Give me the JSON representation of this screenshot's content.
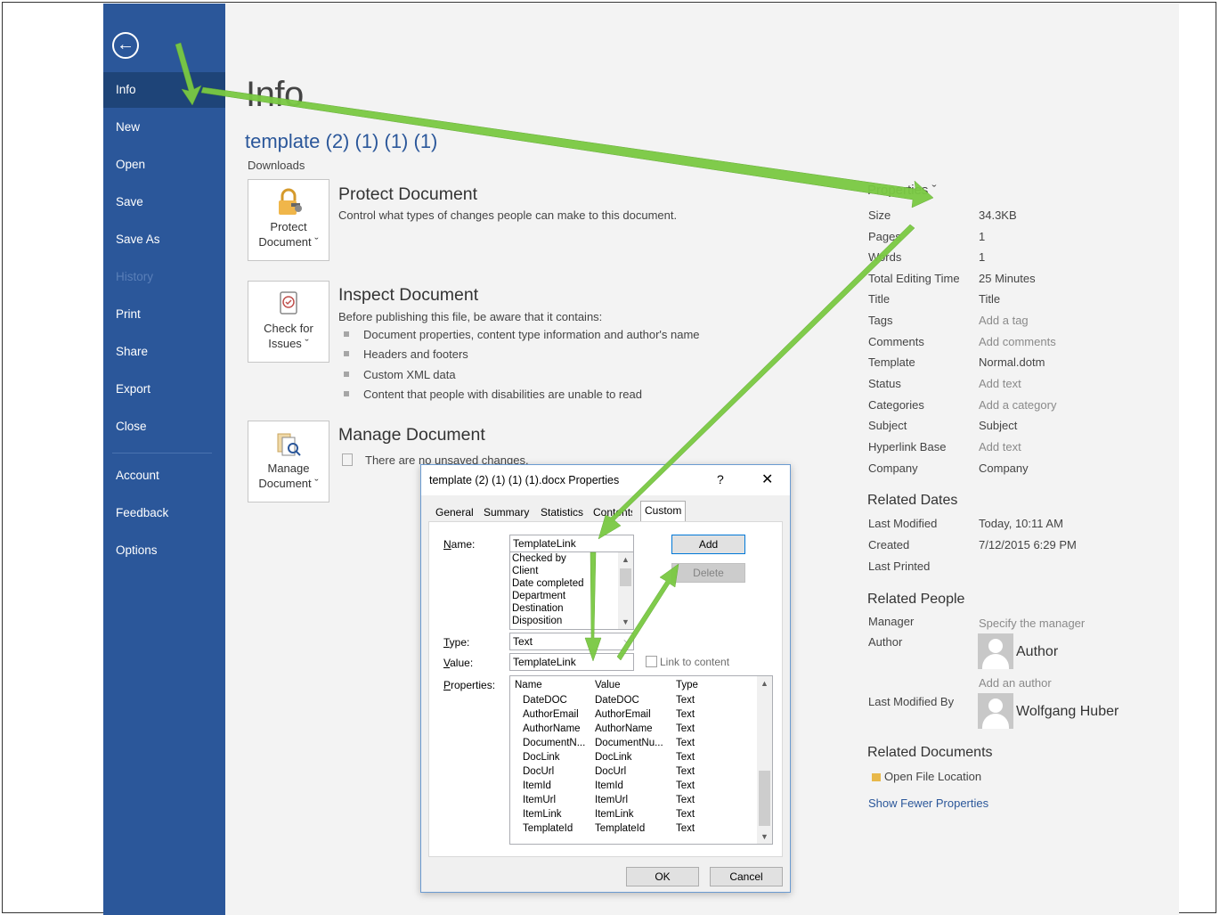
{
  "sidebar": {
    "back_glyph": "←",
    "items": [
      {
        "label": "Info"
      },
      {
        "label": "New"
      },
      {
        "label": "Open"
      },
      {
        "label": "Save"
      },
      {
        "label": "Save As"
      },
      {
        "label": "History"
      },
      {
        "label": "Print"
      },
      {
        "label": "Share"
      },
      {
        "label": "Export"
      },
      {
        "label": "Close"
      },
      {
        "label": "Account"
      },
      {
        "label": "Feedback"
      },
      {
        "label": "Options"
      }
    ]
  },
  "main": {
    "title": "Info",
    "doc_title": "template (2) (1) (1) (1)",
    "doc_location": "Downloads",
    "protect": {
      "button_line1": "Protect",
      "button_line2": "Document ˇ",
      "heading": "Protect Document",
      "description": "Control what types of changes people can make to this document."
    },
    "inspect": {
      "button_line1": "Check for",
      "button_line2": "Issues ˇ",
      "heading": "Inspect Document",
      "description": "Before publishing this file, be aware that it contains:",
      "bullets": [
        "Document properties, content type information and author's name",
        "Headers and footers",
        "Custom XML data",
        "Content that people with disabilities are unable to read"
      ]
    },
    "manage": {
      "button_line1": "Manage",
      "button_line2": "Document ˇ",
      "heading": "Manage Document",
      "description": "There are no unsaved changes."
    }
  },
  "properties": {
    "heading": "Properties ˇ",
    "rows": [
      {
        "label": "Size",
        "value": "34.3KB"
      },
      {
        "label": "Pages",
        "value": "1"
      },
      {
        "label": "Words",
        "value": "1"
      },
      {
        "label": "Total Editing Time",
        "value": "25 Minutes"
      },
      {
        "label": "Title",
        "value": "Title"
      },
      {
        "label": "Tags",
        "value": "Add a tag"
      },
      {
        "label": "Comments",
        "value": "Add comments"
      },
      {
        "label": "Template",
        "value": "Normal.dotm"
      },
      {
        "label": "Status",
        "value": "Add text"
      },
      {
        "label": "Categories",
        "value": "Add a category"
      },
      {
        "label": "Subject",
        "value": "Subject"
      },
      {
        "label": "Hyperlink Base",
        "value": "Add text"
      },
      {
        "label": "Company",
        "value": "Company"
      }
    ],
    "related_dates": {
      "heading": "Related Dates",
      "rows": [
        {
          "label": "Last Modified",
          "value": "Today, 10:11 AM"
        },
        {
          "label": "Created",
          "value": "7/12/2015 6:29 PM"
        },
        {
          "label": "Last Printed",
          "value": ""
        }
      ]
    },
    "related_people": {
      "heading": "Related People",
      "manager_label": "Manager",
      "manager_value": "Specify the manager",
      "author_label": "Author",
      "author_name": "Author",
      "add_author": "Add an author",
      "last_modified_by_label": "Last Modified By",
      "last_modified_by_name": "Wolfgang Huber"
    },
    "related_documents": {
      "heading": "Related Documents",
      "open_file_location": "Open File Location",
      "show_fewer": "Show Fewer Properties"
    }
  },
  "dialog": {
    "title": "template (2) (1) (1) (1).docx Properties",
    "help": "?",
    "close": "✕",
    "tabs": [
      "General",
      "Summary",
      "Statistics",
      "Contents",
      "Custom"
    ],
    "active_tab": "Custom",
    "name_label": "Name:",
    "name_value": "TemplateLink",
    "name_options": [
      "Checked by",
      "Client",
      "Date completed",
      "Department",
      "Destination",
      "Disposition"
    ],
    "type_label": "Type:",
    "type_value": "Text",
    "value_label": "Value:",
    "value_value": "TemplateLink",
    "link_to_content": "Link to content",
    "add_button": "Add",
    "delete_button": "Delete",
    "properties_label": "Properties:",
    "table_headers": [
      "Name",
      "Value",
      "Type"
    ],
    "table_rows": [
      [
        "DateDOC",
        "DateDOC",
        "Text"
      ],
      [
        "AuthorEmail",
        "AuthorEmail",
        "Text"
      ],
      [
        "AuthorName",
        "AuthorName",
        "Text"
      ],
      [
        "DocumentN...",
        "DocumentNu...",
        "Text"
      ],
      [
        "DocLink",
        "DocLink",
        "Text"
      ],
      [
        "DocUrl",
        "DocUrl",
        "Text"
      ],
      [
        "ItemId",
        "ItemId",
        "Text"
      ],
      [
        "ItemUrl",
        "ItemUrl",
        "Text"
      ],
      [
        "ItemLink",
        "ItemLink",
        "Text"
      ],
      [
        "TemplateId",
        "TemplateId",
        "Text"
      ]
    ],
    "ok_button": "OK",
    "cancel_button": "Cancel"
  },
  "colors": {
    "sidebar": "#2b579a",
    "sidebar_active": "#1e4478",
    "annotation_arrow": "#7ac943",
    "link": "#2b579a"
  }
}
